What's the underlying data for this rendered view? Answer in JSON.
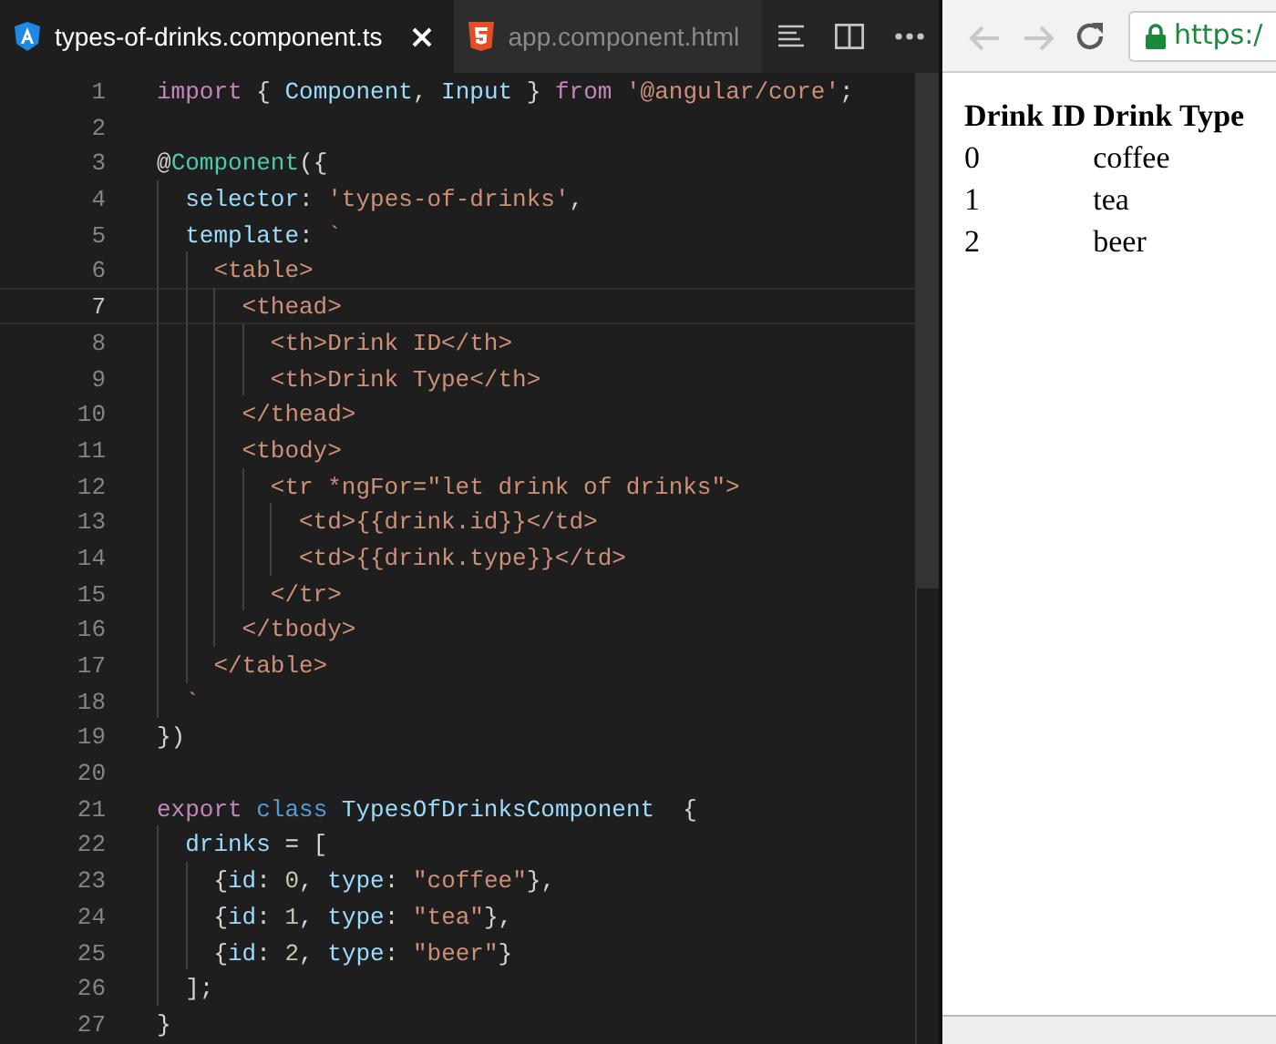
{
  "editor": {
    "tabs": [
      {
        "label": "types-of-drinks.component.ts",
        "selected": true,
        "kind": "angular"
      },
      {
        "label": "app.component.html",
        "selected": false,
        "kind": "html"
      }
    ],
    "lines": [
      {
        "number": "1",
        "current": false,
        "tokens": [
          {
            "kind": "keyword",
            "text": "import"
          },
          {
            "kind": "punct",
            "text": " { "
          },
          {
            "kind": "variable",
            "text": "Component"
          },
          {
            "kind": "punct",
            "text": ", "
          },
          {
            "kind": "variable",
            "text": "Input"
          },
          {
            "kind": "punct",
            "text": " } "
          },
          {
            "kind": "keyword",
            "text": "from "
          },
          {
            "kind": "string",
            "text": "'@angular/core'"
          },
          {
            "kind": "punct",
            "text": ";"
          }
        ]
      },
      {
        "number": "2",
        "current": false
      },
      {
        "number": "3",
        "current": false,
        "tokens": [
          {
            "kind": "punct",
            "text": "@"
          },
          {
            "kind": "type",
            "text": "Component"
          },
          {
            "kind": "punct",
            "text": "({"
          }
        ],
        "children": [
          {
            "number": "4",
            "current": false,
            "tokens": [
              {
                "kind": "variable",
                "text": "selector"
              },
              {
                "kind": "punct",
                "text": ": "
              },
              {
                "kind": "string",
                "text": "'types-of-drinks'"
              },
              {
                "kind": "punct",
                "text": ","
              }
            ]
          },
          {
            "number": "5",
            "current": false,
            "tokens": [
              {
                "kind": "variable",
                "text": "template"
              },
              {
                "kind": "punct",
                "text": ": "
              },
              {
                "kind": "string",
                "text": "`"
              }
            ],
            "children": [
              {
                "number": "6",
                "current": false,
                "tokens": [
                  {
                    "kind": "string",
                    "text": "<table>"
                  }
                ],
                "children": [
                  {
                    "number": "7",
                    "current": true,
                    "tokens": [
                      {
                        "kind": "string",
                        "text": "<thead>"
                      }
                    ],
                    "children": [
                      {
                        "number": "8",
                        "current": false,
                        "tokens": [
                          {
                            "kind": "string",
                            "text": "<th>Drink ID</th>"
                          }
                        ]
                      },
                      {
                        "number": "9",
                        "current": false,
                        "tokens": [
                          {
                            "kind": "string",
                            "text": "<th>Drink Type</th>"
                          }
                        ]
                      }
                    ]
                  },
                  {
                    "number": "10",
                    "current": false,
                    "tokens": [
                      {
                        "kind": "string",
                        "text": "</thead>"
                      }
                    ]
                  },
                  {
                    "number": "11",
                    "current": false,
                    "tokens": [
                      {
                        "kind": "string",
                        "text": "<tbody>"
                      }
                    ],
                    "children": [
                      {
                        "number": "12",
                        "current": false,
                        "tokens": [
                          {
                            "kind": "string",
                            "text": "<tr *ngFor=\"let drink of drinks\">"
                          }
                        ],
                        "children": [
                          {
                            "number": "13",
                            "current": false,
                            "tokens": [
                              {
                                "kind": "string",
                                "text": "<td>{{drink.id}}</td>"
                              }
                            ]
                          },
                          {
                            "number": "14",
                            "current": false,
                            "tokens": [
                              {
                                "kind": "string",
                                "text": "<td>{{drink.type}}</td>"
                              }
                            ]
                          }
                        ]
                      },
                      {
                        "number": "15",
                        "current": false,
                        "tokens": [
                          {
                            "kind": "string",
                            "text": "</tr>"
                          }
                        ]
                      }
                    ]
                  },
                  {
                    "number": "16",
                    "current": false,
                    "tokens": [
                      {
                        "kind": "string",
                        "text": "</tbody>"
                      }
                    ]
                  }
                ]
              },
              {
                "number": "17",
                "current": false,
                "tokens": [
                  {
                    "kind": "string",
                    "text": "</table>"
                  }
                ]
              }
            ]
          },
          {
            "number": "18",
            "current": false,
            "tokens": [
              {
                "kind": "string",
                "text": "`"
              }
            ]
          }
        ]
      },
      {
        "number": "19",
        "current": false,
        "tokens": [
          {
            "kind": "punct",
            "text": "})"
          }
        ]
      },
      {
        "number": "20",
        "current": false
      },
      {
        "number": "21",
        "current": false,
        "tokens": [
          {
            "kind": "keyword",
            "text": "export "
          },
          {
            "kind": "storage",
            "text": "class "
          },
          {
            "kind": "variable",
            "text": "TypesOfDrinksComponent"
          },
          {
            "kind": "punct",
            "text": "  {"
          }
        ],
        "children": [
          {
            "number": "22",
            "current": false,
            "tokens": [
              {
                "kind": "variable",
                "text": "drinks"
              },
              {
                "kind": "punct",
                "text": " = ["
              }
            ],
            "children": [
              {
                "number": "23",
                "current": false,
                "tokens": [
                  {
                    "kind": "punct",
                    "text": "{"
                  },
                  {
                    "kind": "variable",
                    "text": "id"
                  },
                  {
                    "kind": "punct",
                    "text": ": "
                  },
                  {
                    "kind": "number",
                    "text": "0"
                  },
                  {
                    "kind": "punct",
                    "text": ", "
                  },
                  {
                    "kind": "variable",
                    "text": "type"
                  },
                  {
                    "kind": "punct",
                    "text": ": "
                  },
                  {
                    "kind": "string",
                    "text": "\"coffee\""
                  },
                  {
                    "kind": "punct",
                    "text": "},"
                  }
                ]
              },
              {
                "number": "24",
                "current": false,
                "tokens": [
                  {
                    "kind": "punct",
                    "text": "{"
                  },
                  {
                    "kind": "variable",
                    "text": "id"
                  },
                  {
                    "kind": "punct",
                    "text": ": "
                  },
                  {
                    "kind": "number",
                    "text": "1"
                  },
                  {
                    "kind": "punct",
                    "text": ", "
                  },
                  {
                    "kind": "variable",
                    "text": "type"
                  },
                  {
                    "kind": "punct",
                    "text": ": "
                  },
                  {
                    "kind": "string",
                    "text": "\"tea\""
                  },
                  {
                    "kind": "punct",
                    "text": "},"
                  }
                ]
              },
              {
                "number": "25",
                "current": false,
                "tokens": [
                  {
                    "kind": "punct",
                    "text": "{"
                  },
                  {
                    "kind": "variable",
                    "text": "id"
                  },
                  {
                    "kind": "punct",
                    "text": ": "
                  },
                  {
                    "kind": "number",
                    "text": "2"
                  },
                  {
                    "kind": "punct",
                    "text": ", "
                  },
                  {
                    "kind": "variable",
                    "text": "type"
                  },
                  {
                    "kind": "punct",
                    "text": ": "
                  },
                  {
                    "kind": "string",
                    "text": "\"beer\""
                  },
                  {
                    "kind": "punct",
                    "text": "}"
                  }
                ]
              }
            ]
          },
          {
            "number": "26",
            "current": false,
            "tokens": [
              {
                "kind": "punct",
                "text": "];"
              }
            ]
          }
        ]
      },
      {
        "number": "27",
        "current": false,
        "tokens": [
          {
            "kind": "punct",
            "text": "}"
          }
        ]
      }
    ]
  },
  "browser": {
    "back": {
      "disabled": true
    },
    "forward": {
      "disabled": true
    },
    "address": "https:/",
    "table": {
      "columns": [
        "Drink ID",
        "Drink Type"
      ],
      "rows": [
        [
          "0",
          "coffee"
        ],
        [
          "1",
          "tea"
        ],
        [
          "2",
          "beer"
        ]
      ]
    }
  }
}
